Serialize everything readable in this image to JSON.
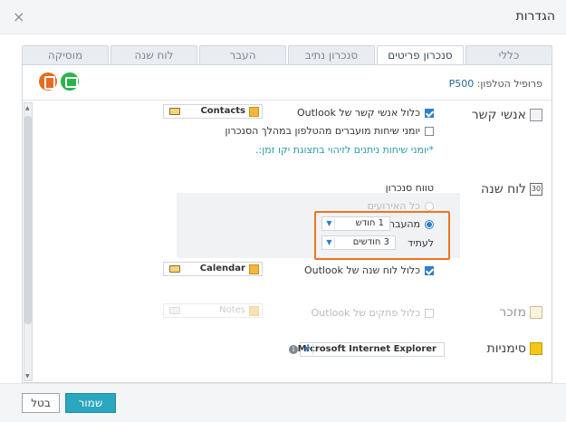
{
  "window": {
    "title": "הגדרות",
    "close_glyph": "×"
  },
  "tabs": [
    {
      "label": "כללי",
      "active": false
    },
    {
      "label": "סנכרון פריטים",
      "active": true
    },
    {
      "label": "סנכרון נתיב",
      "active": false
    },
    {
      "label": "העבר",
      "active": false
    },
    {
      "label": "לוח שנה",
      "active": false
    },
    {
      "label": "מוסיקה",
      "active": false
    }
  ],
  "profile": {
    "label": "פרופיל הטלפון:",
    "model": "P500"
  },
  "contacts": {
    "section_label": "אנשי קשר",
    "icon": "contact-card-icon",
    "sync_all_label": "כלול אנשי קשר של Outlook",
    "folder": "Contacts",
    "transferred_label": "יומני שיחות מועברים מהטלפון במהלך הסנכרון",
    "note": "*יומני שיחות ניתנים לזיהוי בתצוגת יקו זמן:."
  },
  "calendar": {
    "section_label": "לוח שנה",
    "icon_text": "30",
    "range_title": "טווח סנכרון",
    "all_events_label": "כל האירועים",
    "past_label": "מהעבר",
    "past_value": "1 חודש",
    "future_label": "לעתיד",
    "future_value": "3 חודשים",
    "sync_all_label": "כלול לוח שנה של Outlook",
    "folder": "Calendar"
  },
  "notes": {
    "section_label": "מזכר",
    "sync_all_label": "כלול פתקים של Outlook",
    "folder": "Notes"
  },
  "bookmarks": {
    "section_label": "סימניות",
    "browser": "Microsoft Internet Explorer",
    "info_glyph": "i"
  },
  "footer": {
    "save_label": "שמור",
    "cancel_label": "בטל"
  },
  "colors": {
    "accent": "#2aa6bf",
    "highlight": "#f07322",
    "checkbox": "#2f7fc9"
  }
}
